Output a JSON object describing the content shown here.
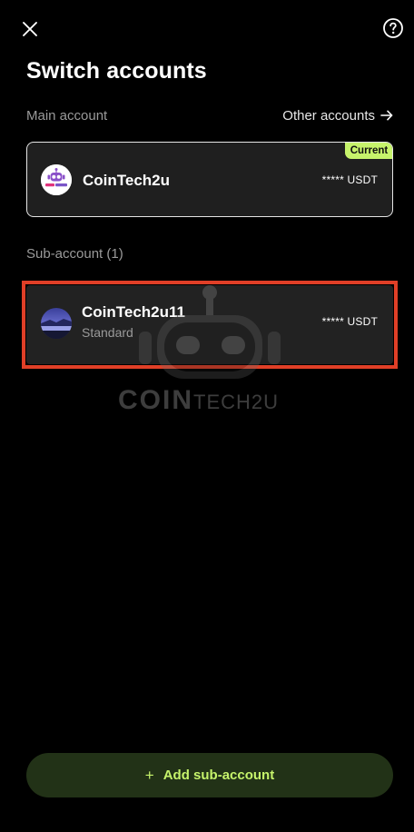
{
  "header": {
    "close_icon": "close-icon",
    "help_icon": "help-circle-icon"
  },
  "title": "Switch accounts",
  "main_section": {
    "label": "Main account",
    "other_accounts_label": "Other accounts",
    "other_accounts_icon": "arrow-right-icon"
  },
  "main_account": {
    "name": "CoinTech2u",
    "balance": "***** USDT",
    "badge": "Current",
    "avatar_icon": "robot-logo-avatar"
  },
  "sub_section": {
    "label": "Sub-account (1)"
  },
  "sub_accounts": [
    {
      "name": "CoinTech2u11",
      "type": "Standard",
      "balance": "***** USDT",
      "avatar_icon": "landscape-photo-avatar"
    }
  ],
  "watermark": {
    "coin": "COIN",
    "tech": "TECH2U"
  },
  "add_button": {
    "label": "Add sub-account",
    "icon": "plus-icon"
  },
  "colors": {
    "background": "#000000",
    "card": "#1f1f1f",
    "accent": "#c6f36b",
    "highlight_border": "#e03f27",
    "muted_text": "#9a9a9a"
  }
}
